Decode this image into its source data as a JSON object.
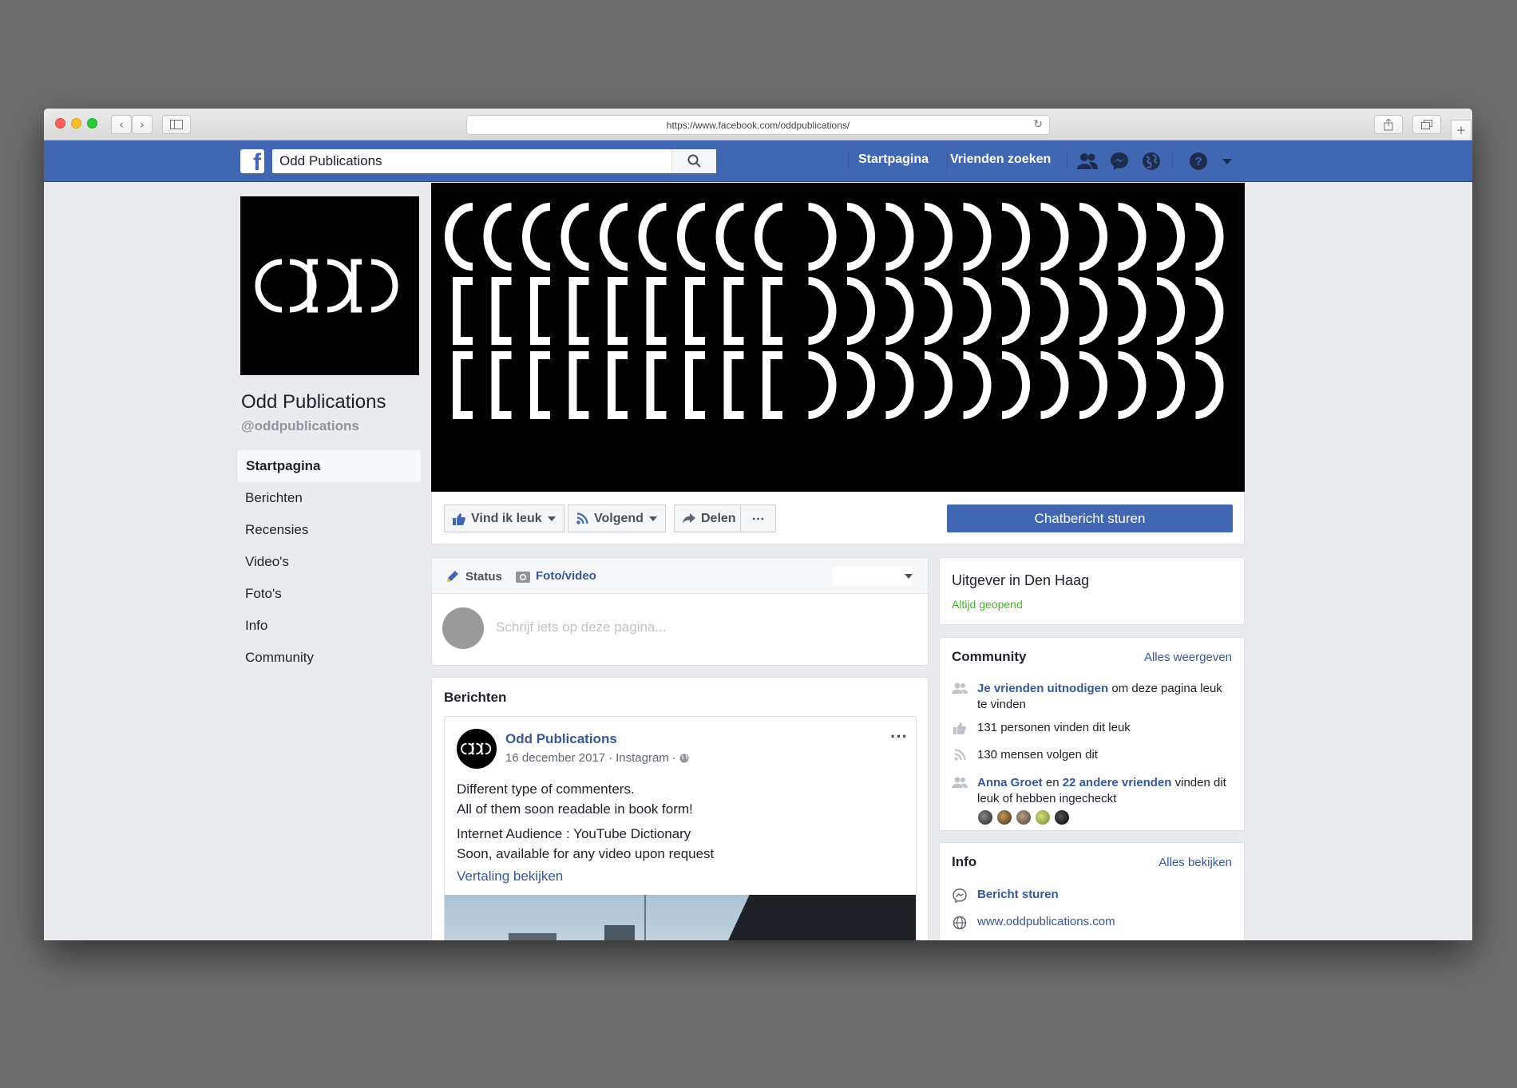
{
  "browser": {
    "url": "https://www.facebook.com/oddpublications/"
  },
  "topbar": {
    "search_value": "Odd Publications",
    "nav_home": "Startpagina",
    "nav_find_friends": "Vrienden zoeken"
  },
  "page": {
    "logo_text": "ODD",
    "name": "Odd Publications",
    "handle": "@oddpublications"
  },
  "sidebar": {
    "items": [
      {
        "label": "Startpagina"
      },
      {
        "label": "Berichten"
      },
      {
        "label": "Recensies"
      },
      {
        "label": "Video's"
      },
      {
        "label": "Foto's"
      },
      {
        "label": "Info"
      },
      {
        "label": "Community"
      }
    ]
  },
  "actions": {
    "like": "Vind ik leuk",
    "following": "Volgend",
    "share": "Delen",
    "more": "⋯",
    "message": "Chatbericht sturen"
  },
  "composer": {
    "tab_status": "Status",
    "tab_photo": "Foto/video",
    "placeholder": "Schrijf iets op deze pagina..."
  },
  "posts": {
    "title": "Berichten",
    "post": {
      "author": "Odd Publications",
      "date": "16 december 2017",
      "source": "Instagram",
      "line1": "Different type of commenters.",
      "line2": "All of them soon readable in book form!",
      "line3": "Internet Audience : YouTube Dictionary",
      "line4": "Soon, available for any video upon request",
      "translate": "Vertaling bekijken"
    }
  },
  "about": {
    "category": "Uitgever in Den Haag",
    "hours": "Altijd geopend"
  },
  "community": {
    "title": "Community",
    "see_all": "Alles weergeven",
    "invite_link": "Je vrienden uitnodigen",
    "invite_rest": "om deze pagina leuk te vinden",
    "likes": "131 personen vinden dit leuk",
    "follows": "130 mensen volgen dit",
    "friend_name": "Anna Groet",
    "friend_mid": "en",
    "friend_others": "22 andere vrienden",
    "friend_rest": "vinden dit leuk of hebben ingecheckt"
  },
  "info": {
    "title": "Info",
    "see_all": "Alles bekijken",
    "message": "Bericht sturen",
    "website": "www.oddpublications.com"
  },
  "colors": {
    "facebook_blue": "#4267b2",
    "link_blue": "#385898",
    "open_green": "#42b72a"
  }
}
